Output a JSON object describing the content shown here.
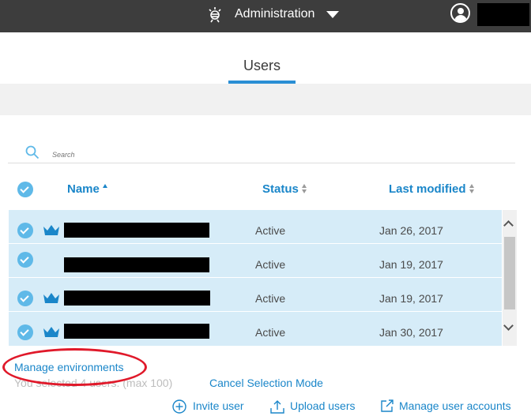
{
  "topbar": {
    "title": "Administration",
    "icons": {
      "app": "ibm-bee-icon",
      "menu": "caret-down-icon",
      "user": "user-avatar-icon"
    }
  },
  "tabs": {
    "active": "Users"
  },
  "search": {
    "placeholder": "Search"
  },
  "table": {
    "columns": {
      "name": "Name",
      "status": "Status",
      "last_modified": "Last modified"
    },
    "sort": {
      "name": "ascending"
    },
    "rows": [
      {
        "status": "Active",
        "last_modified": "Jan 26, 2017",
        "is_admin": true,
        "selected": true
      },
      {
        "status": "Active",
        "last_modified": "Jan 19, 2017",
        "is_admin": false,
        "selected": true
      },
      {
        "status": "Active",
        "last_modified": "Jan 19, 2017",
        "is_admin": true,
        "selected": true
      },
      {
        "status": "Active",
        "last_modified": "Jan 30, 2017",
        "is_admin": true,
        "selected": true
      }
    ]
  },
  "footer": {
    "manage_environments": "Manage environments",
    "selection_text": "You selected 4 users. (max 100)",
    "cancel_selection": "Cancel Selection Mode",
    "actions": {
      "invite": "Invite user",
      "upload": "Upload users",
      "manage_accounts": "Manage user accounts"
    }
  },
  "colors": {
    "topbar_bg": "#3d3d3d",
    "accent": "#1a86c9",
    "row_selected": "#d6ecf8",
    "check_bg": "#5fb9e8",
    "annotation_red": "#e0192a"
  }
}
